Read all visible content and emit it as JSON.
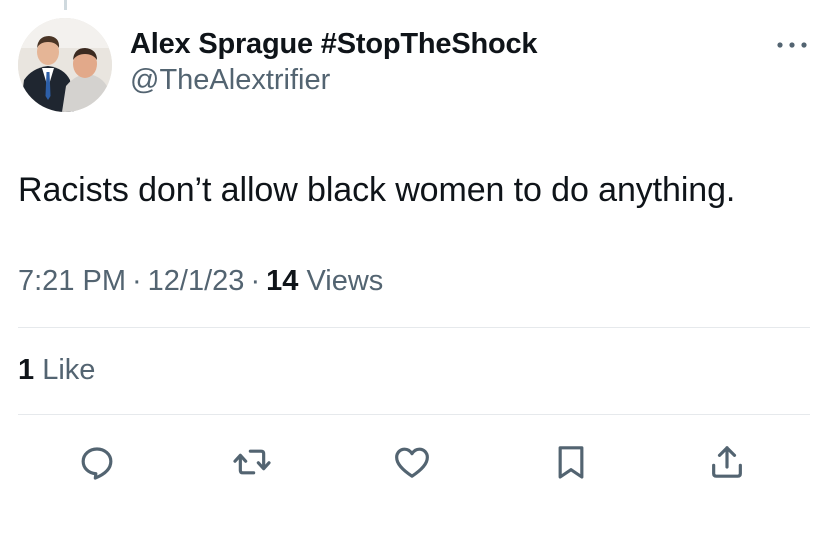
{
  "author": {
    "display_name": "Alex Sprague #StopTheShock",
    "handle": "@TheAlextrifier"
  },
  "tweet": {
    "text": "Racists don’t allow black women to do anything."
  },
  "meta": {
    "time": "7:21 PM",
    "separator": "·",
    "date": "12/1/23",
    "views_count": "14",
    "views_label": "Views"
  },
  "engagement": {
    "likes_count": "1",
    "likes_label": "Like"
  },
  "icons": {
    "more": "more-horizontal-icon",
    "reply": "reply-icon",
    "retweet": "retweet-icon",
    "like": "heart-icon",
    "bookmark": "bookmark-icon",
    "share": "share-icon"
  },
  "colors": {
    "text_primary": "#0f1419",
    "text_secondary": "#536471",
    "divider": "#e6e9ec",
    "background": "#ffffff"
  }
}
